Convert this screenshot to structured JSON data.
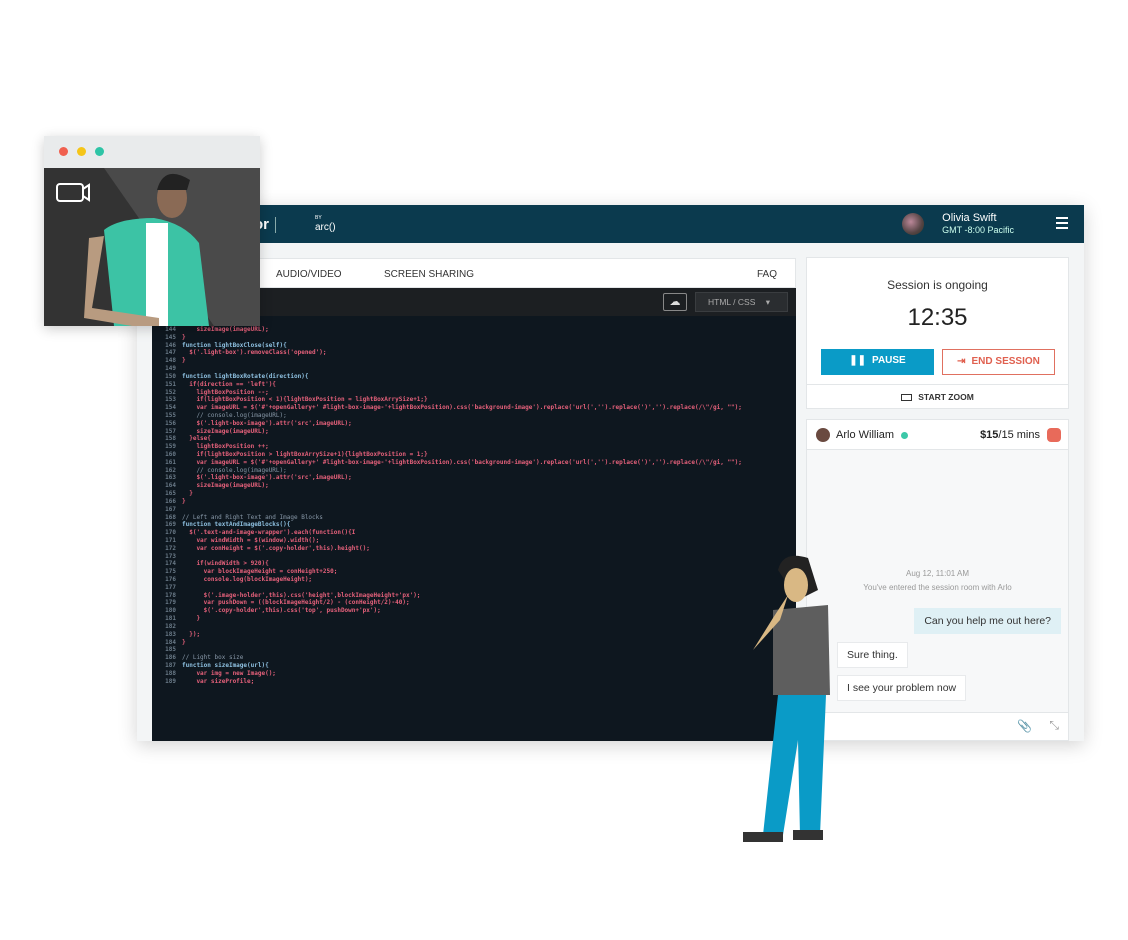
{
  "header": {
    "logo": "or",
    "logo_by": "BY",
    "logo_brand": "arc()",
    "user_name": "Olivia Swift",
    "user_timezone": "GMT -8:00 Pacific"
  },
  "tabs": {
    "audio_video": "AUDIO/VIDEO",
    "screen_sharing": "SCREEN SHARING",
    "faq": "FAQ"
  },
  "editor": {
    "language": "HTML / CSS",
    "lines": [
      {
        "n": "144",
        "t": "    sizeImage(imageURL);"
      },
      {
        "n": "145",
        "t": "}"
      },
      {
        "n": "146",
        "t": "function lightBoxClose(self){"
      },
      {
        "n": "147",
        "t": "  $('.light-box').removeClass('opened');"
      },
      {
        "n": "148",
        "t": "}"
      },
      {
        "n": "149",
        "t": ""
      },
      {
        "n": "150",
        "t": "function lightBoxRotate(direction){"
      },
      {
        "n": "151",
        "t": "  if(direction == 'left'){"
      },
      {
        "n": "152",
        "t": "    lightBoxPosition --;"
      },
      {
        "n": "153",
        "t": "    if(lightBoxPosition < 1){lightBoxPosition = lightBoxArrySize+1;}"
      },
      {
        "n": "154",
        "t": "    var imageURL = $('#'+openGallery+' #light-box-image-'+lightBoxPosition).css('background-image').replace('url(','').replace(')','').replace(/\\\"/gi, \"\");"
      },
      {
        "n": "155",
        "t": "    // console.log(imageURL);"
      },
      {
        "n": "156",
        "t": "    $('.light-box-image').attr('src',imageURL);"
      },
      {
        "n": "157",
        "t": "    sizeImage(imageURL);"
      },
      {
        "n": "158",
        "t": "  }else{"
      },
      {
        "n": "159",
        "t": "    lightBoxPosition ++;"
      },
      {
        "n": "160",
        "t": "    if(lightBoxPosition > lightBoxArrySize+1){lightBoxPosition = 1;}"
      },
      {
        "n": "161",
        "t": "    var imageURL = $('#'+openGallery+' #light-box-image-'+lightBoxPosition).css('background-image').replace('url(','').replace(')','').replace(/\\\"/gi, \"\");"
      },
      {
        "n": "162",
        "t": "    // console.log(imageURL);"
      },
      {
        "n": "163",
        "t": "    $('.light-box-image').attr('src',imageURL);"
      },
      {
        "n": "164",
        "t": "    sizeImage(imageURL);"
      },
      {
        "n": "165",
        "t": "  }"
      },
      {
        "n": "166",
        "t": "}"
      },
      {
        "n": "167",
        "t": ""
      },
      {
        "n": "168",
        "t": "// Left and Right Text and Image Blocks"
      },
      {
        "n": "169",
        "t": "function textAndImageBlocks(){"
      },
      {
        "n": "170",
        "t": "  $('.text-and-image-wrapper').each(function(){I"
      },
      {
        "n": "171",
        "t": "    var windWidth = $(window).width();"
      },
      {
        "n": "172",
        "t": "    var conHeight = $('.copy-holder',this).height();"
      },
      {
        "n": "173",
        "t": ""
      },
      {
        "n": "174",
        "t": "    if(windWidth > 920){"
      },
      {
        "n": "175",
        "t": "      var blockImageHeight = conHeight+250;"
      },
      {
        "n": "176",
        "t": "      console.log(blockImageHeight);"
      },
      {
        "n": "177",
        "t": ""
      },
      {
        "n": "178",
        "t": "      $('.image-holder',this).css('height',blockImageHeight+'px');"
      },
      {
        "n": "179",
        "t": "      var pushDown = ((blockImageHeight/2) - (conHeight/2)-40);"
      },
      {
        "n": "180",
        "t": "      $('.copy-holder',this).css('top', pushDown+'px');"
      },
      {
        "n": "181",
        "t": "    }"
      },
      {
        "n": "182",
        "t": ""
      },
      {
        "n": "183",
        "t": "  });"
      },
      {
        "n": "184",
        "t": "}"
      },
      {
        "n": "185",
        "t": ""
      },
      {
        "n": "186",
        "t": "// Light box size"
      },
      {
        "n": "187",
        "t": "function sizeImage(url){"
      },
      {
        "n": "188",
        "t": "    var img = new Image();"
      },
      {
        "n": "189",
        "t": "    var sizeProfile;"
      }
    ]
  },
  "session": {
    "status": "Session is ongoing",
    "timer": "12:35",
    "pause_label": "PAUSE",
    "end_label": "END SESSION",
    "zoom_label": "START ZOOM"
  },
  "chat": {
    "partner_name": "Arlo William",
    "partner_online": true,
    "price": "$15",
    "duration": "/15 mins",
    "date": "Aug 12, 11:01 AM",
    "system_message": "You've entered the session room with Arlo",
    "messages": [
      {
        "from": "me",
        "text": "Can you help me out here?"
      },
      {
        "from": "partner",
        "text": "Sure thing."
      },
      {
        "from": "partner",
        "text": "I see your problem now"
      }
    ]
  },
  "colors": {
    "header": "#0b3a4e",
    "primary": "#0a9bc7",
    "danger": "#e0604f",
    "online": "#3cc8a8",
    "bubble_me": "#dff0f5"
  }
}
